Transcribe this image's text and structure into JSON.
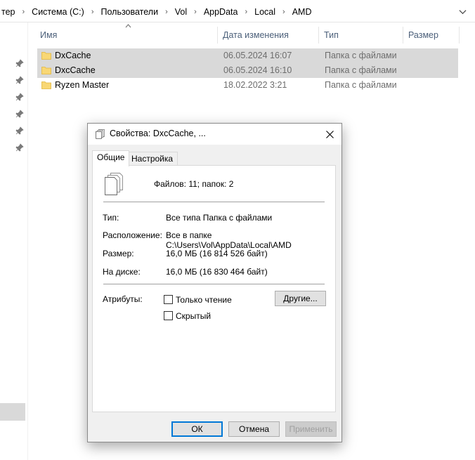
{
  "address": {
    "crumbs": [
      "тер",
      "Система (C:)",
      "Пользователи",
      "Vol",
      "AppData",
      "Local",
      "AMD"
    ],
    "separator": "›",
    "dropdown_icon": "chevron-down-icon"
  },
  "columns": {
    "name": "Имя",
    "date": "Дата изменения",
    "type": "Тип",
    "size": "Размер"
  },
  "files": [
    {
      "name": "DxCache",
      "date": "06.05.2024 16:07",
      "type": "Папка с файлами",
      "selected": true
    },
    {
      "name": "DxcCache",
      "date": "06.05.2024 16:10",
      "type": "Папка с файлами",
      "selected": true
    },
    {
      "name": "Ryzen Master",
      "date": "18.02.2022 3:21",
      "type": "Папка с файлами",
      "selected": false
    }
  ],
  "colors": {
    "folder": "#f8d775",
    "selection": "#d9d9d9",
    "accent": "#0078d7"
  },
  "dialog": {
    "title": "Свойства: DxcCache, ...",
    "tabs": [
      "Общие",
      "Настройка"
    ],
    "counts": "Файлов: 11; папок: 2",
    "props": [
      {
        "label": "Тип:",
        "value": "Все типа Папка с файлами"
      },
      {
        "label": "Расположение:",
        "value": "Все в папке C:\\Users\\Vol\\AppData\\Local\\AMD"
      },
      {
        "label": "Размер:",
        "value": "16,0 МБ (16 814 526 байт)"
      },
      {
        "label": "На диске:",
        "value": "16,0 МБ (16 830 464 байт)"
      }
    ],
    "attributes_label": "Атрибуты:",
    "readonly_label": "Только чтение",
    "hidden_label": "Скрытый",
    "other_button": "Другие...",
    "ok_button": "ОК",
    "cancel_button": "Отмена",
    "apply_button": "Применить"
  }
}
